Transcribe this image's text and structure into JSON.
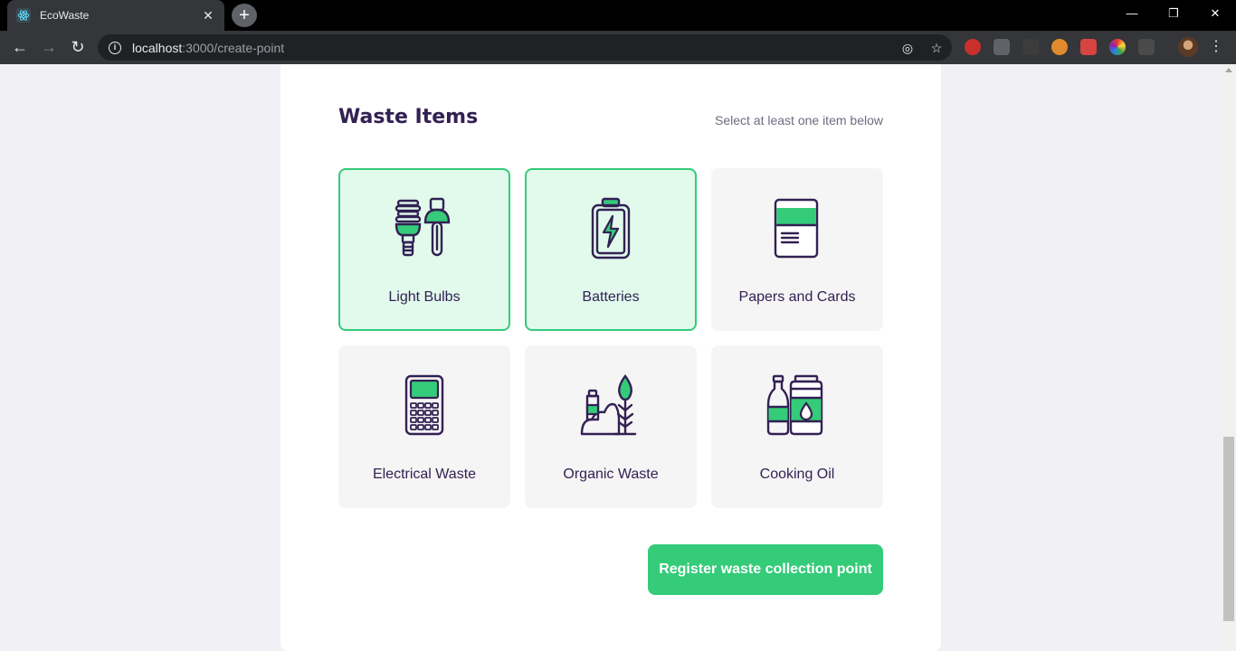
{
  "browser": {
    "tab_title": "EcoWaste",
    "url_host": "localhost",
    "url_path": ":3000/create-point",
    "new_tab": "+",
    "close_tab": "✕",
    "window_controls": {
      "minimize": "—",
      "restore": "❐",
      "close": "✕"
    },
    "nav": {
      "back": "←",
      "forward": "→",
      "reload": "↻"
    },
    "extensions": [
      "adblock-icon",
      "tab-icon",
      "json-icon",
      "glasses-icon",
      "puzzle-icon",
      "color-icon",
      "flag-icon"
    ]
  },
  "section": {
    "title": "Waste Items",
    "hint": "Select at least one item below"
  },
  "items": [
    {
      "label": "Light Bulbs",
      "icon": "light-bulbs-icon",
      "selected": true
    },
    {
      "label": "Batteries",
      "icon": "batteries-icon",
      "selected": true
    },
    {
      "label": "Papers and Cards",
      "icon": "papers-icon",
      "selected": false
    },
    {
      "label": "Electrical Waste",
      "icon": "electrical-icon",
      "selected": false
    },
    {
      "label": "Organic Waste",
      "icon": "organic-icon",
      "selected": false
    },
    {
      "label": "Cooking Oil",
      "icon": "cooking-oil-icon",
      "selected": false
    }
  ],
  "submit_label": "Register waste collection point",
  "colors": {
    "primary": "#34CB79",
    "title": "#322153",
    "selected_bg": "#E1FAEC",
    "item_bg": "#F5F5F5"
  }
}
